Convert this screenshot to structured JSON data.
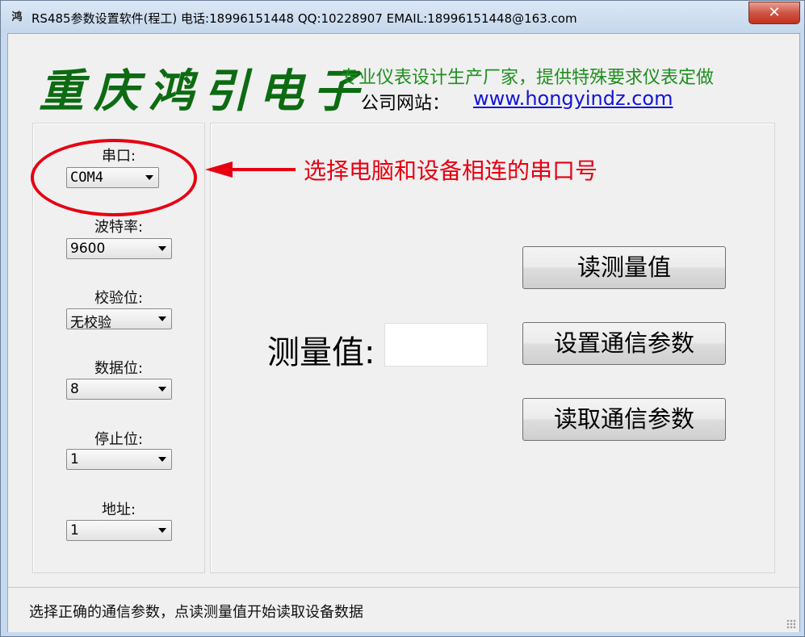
{
  "window": {
    "title": "RS485参数设置软件(程工)  电话:18996151448  QQ:10228907  EMAIL:18996151448@163.com",
    "close_label": "✕",
    "icon": "app-logo-icon"
  },
  "header": {
    "brand": "重庆鸿引电子",
    "slogan": "专业仪表设计生产厂家，提供特殊要求仪表定做",
    "website_label": "公司网站：",
    "website_url": "www.hongyindz.com"
  },
  "settings": {
    "port_label": "串口:",
    "port_value": "COM4",
    "baud_label": "波特率:",
    "baud_value": "9600",
    "parity_label": "校验位:",
    "parity_value": "无校验",
    "databits_label": "数据位:",
    "databits_value": "8",
    "stopbits_label": "停止位:",
    "stopbits_value": "1",
    "address_label": "地址:",
    "address_value": "1"
  },
  "annotation": {
    "text": "选择电脑和设备相连的串口号",
    "color": "#e60012"
  },
  "main": {
    "measure_label": "测量值:",
    "measure_value": "",
    "read_measure_button": "读测量值",
    "set_params_button": "设置通信参数",
    "read_params_button": "读取通信参数"
  },
  "status": {
    "text": "选择正确的通信参数，点读测量值开始读取设备数据"
  },
  "colors": {
    "brand": "#0d6b12",
    "slogan": "#1f8f1f",
    "link": "#1414d8",
    "annotation": "#e60012"
  }
}
